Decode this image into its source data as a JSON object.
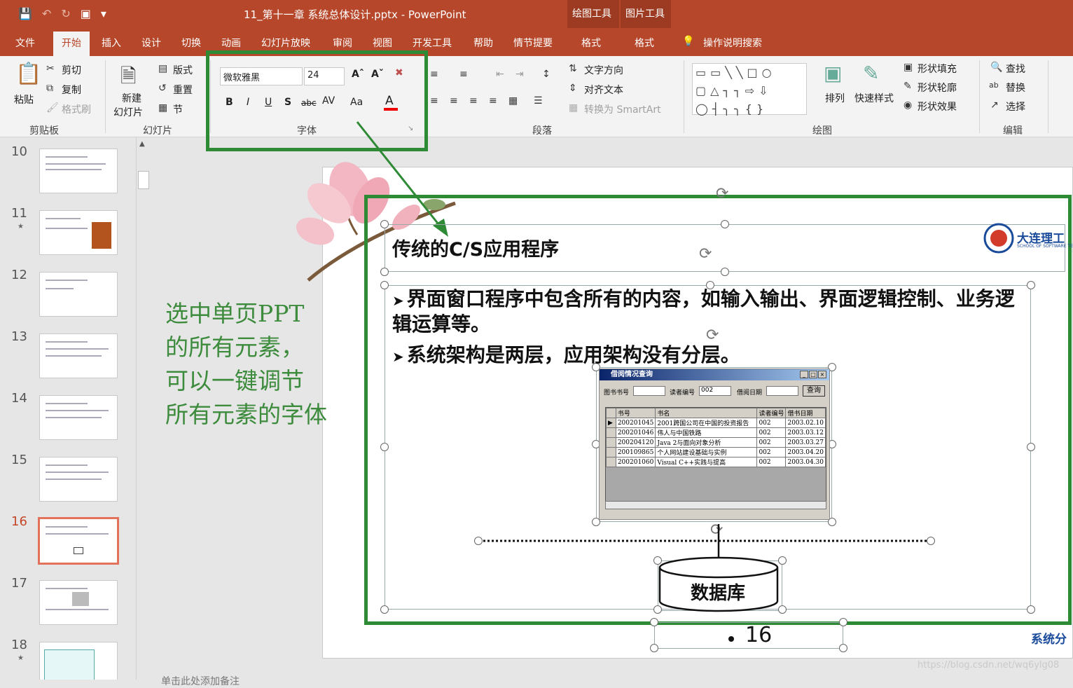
{
  "window": {
    "title": "11_第十一章 系统总体设计.pptx  -  PowerPoint",
    "contextual_groups": [
      {
        "label": "绘图工具",
        "tab": "格式"
      },
      {
        "label": "图片工具",
        "tab": "格式"
      }
    ]
  },
  "ribbon_tabs": [
    "文件",
    "开始",
    "插入",
    "设计",
    "切换",
    "动画",
    "幻灯片放映",
    "审阅",
    "视图",
    "开发工具",
    "帮助",
    "情节提要"
  ],
  "active_tab": "开始",
  "tell_me": "操作说明搜索",
  "ribbon": {
    "clipboard": {
      "label": "剪贴板",
      "paste": "粘贴",
      "cut": "剪切",
      "copy": "复制",
      "format_painter": "格式刷"
    },
    "slides": {
      "label": "幻灯片",
      "new_slide_line1": "新建",
      "new_slide_line2": "幻灯片",
      "layout": "版式",
      "reset": "重置",
      "section": "节"
    },
    "font": {
      "label": "字体",
      "font_name": "微软雅黑",
      "font_size": "24",
      "bold": "B",
      "italic": "I",
      "underline": "U",
      "shadow": "S",
      "strike": "abc",
      "spacing": "AV",
      "case": "Aa",
      "color_a": "A"
    },
    "paragraph": {
      "label": "段落",
      "text_direction": "文字方向",
      "align_text": "对齐文本",
      "smartart": "转换为 SmartArt"
    },
    "drawing": {
      "label": "绘图",
      "arrange": "排列",
      "quick_styles": "快速样式",
      "shape_fill": "形状填充",
      "shape_outline": "形状轮廓",
      "shape_effects": "形状效果"
    },
    "editing": {
      "label": "编辑",
      "find": "查找",
      "replace": "替换",
      "select": "选择"
    }
  },
  "thumbnails": [
    {
      "num": "10",
      "star": false,
      "active": false
    },
    {
      "num": "11",
      "star": true,
      "active": false
    },
    {
      "num": "12",
      "star": false,
      "active": false
    },
    {
      "num": "13",
      "star": false,
      "active": false
    },
    {
      "num": "14",
      "star": false,
      "active": false
    },
    {
      "num": "15",
      "star": false,
      "active": false
    },
    {
      "num": "16",
      "star": false,
      "active": true
    },
    {
      "num": "17",
      "star": false,
      "active": false
    },
    {
      "num": "18",
      "star": true,
      "active": false
    }
  ],
  "annotation": "选中单页PPT\n的所有元素，\n可以一键调节\n所有元素的字体",
  "slide": {
    "title": "传统的C/S应用程序",
    "bullets": [
      "界面窗口程序中包含所有的内容，如输入输出、界面逻辑控制、业务逻辑运算等。",
      "系统架构是两层，应用架构没有分层。"
    ],
    "logo_text": "大连理工",
    "logo_sub": "SCHOOL OF SOFTWARE TE",
    "db_label": "数据库",
    "page_number": "16",
    "footer_text": "系统分"
  },
  "app_window": {
    "title": "借阅情况查询",
    "fields": [
      {
        "label": "图书书号",
        "value": ""
      },
      {
        "label": "读者编号",
        "value": "002"
      },
      {
        "label": "借阅日期",
        "value": ""
      }
    ],
    "query_button": "查询",
    "columns": [
      "书号",
      "书名",
      "读者编号",
      "借书日期"
    ],
    "rows": [
      [
        "200201045",
        "2001跨国公司在中国的投资报告",
        "002",
        "2003.02.10"
      ],
      [
        "200201046",
        "伟人与中国铁路",
        "002",
        "2003.03.12"
      ],
      [
        "200204120",
        "Java 2与面向对象分析",
        "002",
        "2003.03.27"
      ],
      [
        "200109865",
        "个人网站建设基础与实例",
        "002",
        "2003.04.20"
      ],
      [
        "200201060",
        "Visual C++实践与提高",
        "002",
        "2003.04.30"
      ]
    ]
  },
  "watermark": "https://blog.csdn.net/wq6ylg08",
  "notes_stub": "单击此处添加备注",
  "colors": {
    "accent": "#b7472a",
    "highlight_box": "#2f8a36",
    "annotation_text": "#3d8b3d"
  }
}
